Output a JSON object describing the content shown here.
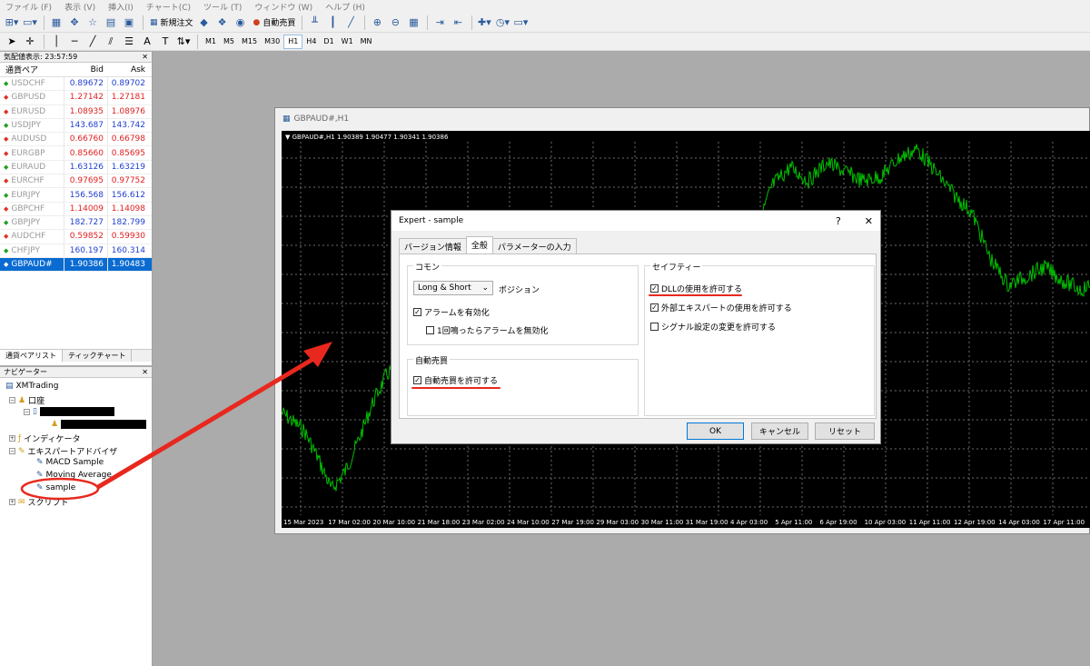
{
  "menubar": {
    "items": [
      "ファイル (F)",
      "表示 (V)",
      "挿入(I)",
      "チャート(C)",
      "ツール (T)",
      "ウィンドウ (W)",
      "ヘルプ (H)"
    ]
  },
  "toolbar": {
    "new_order_label": "新規注文",
    "auto_trade_label": "自動売買",
    "timeframes": [
      "M1",
      "M5",
      "M15",
      "M30",
      "H1",
      "H4",
      "D1",
      "W1",
      "MN"
    ],
    "active_timeframe": "H1"
  },
  "market_watch": {
    "title": "気配値表示: 23:57:59",
    "columns": {
      "symbol": "通貨ペア",
      "bid": "Bid",
      "ask": "Ask"
    },
    "rows": [
      {
        "symbol": "USDCHF",
        "bid": "0.89672",
        "ask": "0.89702",
        "dir": "up",
        "color": "#2040d0"
      },
      {
        "symbol": "GBPUSD",
        "bid": "1.27142",
        "ask": "1.27181",
        "dir": "down",
        "color": "#e02020"
      },
      {
        "symbol": "EURUSD",
        "bid": "1.08935",
        "ask": "1.08976",
        "dir": "down",
        "color": "#e02020"
      },
      {
        "symbol": "USDJPY",
        "bid": "143.687",
        "ask": "143.742",
        "dir": "up",
        "color": "#2040d0"
      },
      {
        "symbol": "AUDUSD",
        "bid": "0.66760",
        "ask": "0.66798",
        "dir": "down",
        "color": "#e02020"
      },
      {
        "symbol": "EURGBP",
        "bid": "0.85660",
        "ask": "0.85695",
        "dir": "down",
        "color": "#e02020"
      },
      {
        "symbol": "EURAUD",
        "bid": "1.63126",
        "ask": "1.63219",
        "dir": "up",
        "color": "#2040d0"
      },
      {
        "symbol": "EURCHF",
        "bid": "0.97695",
        "ask": "0.97752",
        "dir": "down",
        "color": "#e02020"
      },
      {
        "symbol": "EURJPY",
        "bid": "156.568",
        "ask": "156.612",
        "dir": "up",
        "color": "#2040d0"
      },
      {
        "symbol": "GBPCHF",
        "bid": "1.14009",
        "ask": "1.14098",
        "dir": "down",
        "color": "#e02020"
      },
      {
        "symbol": "GBPJPY",
        "bid": "182.727",
        "ask": "182.799",
        "dir": "up",
        "color": "#2040d0"
      },
      {
        "symbol": "AUDCHF",
        "bid": "0.59852",
        "ask": "0.59930",
        "dir": "down",
        "color": "#e02020"
      },
      {
        "symbol": "CHFJPY",
        "bid": "160.197",
        "ask": "160.314",
        "dir": "up",
        "color": "#2040d0"
      },
      {
        "symbol": "GBPAUD#",
        "bid": "1.90386",
        "ask": "1.90483",
        "dir": "up",
        "color": "#ffffff",
        "selected": true
      }
    ],
    "tabs": [
      "通貨ペアリスト",
      "ティックチャート"
    ]
  },
  "navigator": {
    "title": "ナビゲーター",
    "root": "XMTrading",
    "account": "口座",
    "indicators": "インディケータ",
    "experts": "エキスパートアドバイザ",
    "expert_items": [
      "MACD Sample",
      "Moving Average",
      "sample"
    ],
    "scripts": "スクリプト"
  },
  "chart": {
    "window_title": "GBPAUD#,H1",
    "info": "▼ GBPAUD#,H1  1.90389 1.90477 1.90341 1.90386",
    "x_labels": [
      "15 Mar 2023",
      "17 Mar 02:00",
      "20 Mar 10:00",
      "21 Mar 18:00",
      "23 Mar 02:00",
      "24 Mar 10:00",
      "27 Mar 19:00",
      "29 Mar 03:00",
      "30 Mar 11:00",
      "31 Mar 19:00",
      "4 Apr 03:00",
      "5 Apr 11:00",
      "6 Apr 19:00",
      "10 Apr 03:00",
      "11 Apr 11:00",
      "12 Apr 19:00",
      "14 Apr 03:00",
      "17 Apr 11:00"
    ],
    "line_color": "#00c000",
    "grid_color": "#6b6b6b"
  },
  "dialog": {
    "title": "Expert - sample",
    "help_label": "?",
    "close_label": "✕",
    "tabs": [
      "バージョン情報",
      "全般",
      "パラメーターの入力"
    ],
    "active_tab": "全般",
    "common_group": "コモン",
    "position_select": "Long & Short",
    "position_label": "ポジション",
    "enable_alerts": "アラームを有効化",
    "disable_alert_once": "1回鳴ったらアラームを無効化",
    "auto_trade_group": "自動売買",
    "allow_auto_trade": "自動売買を許可する",
    "safety_group": "セイフティー",
    "allow_dll": "DLLの使用を許可する",
    "allow_external_experts": "外部エキスパートの使用を許可する",
    "allow_signal_change": "シグナル設定の変更を許可する",
    "ok_label": "OK",
    "cancel_label": "キャンセル",
    "reset_label": "リセット"
  }
}
